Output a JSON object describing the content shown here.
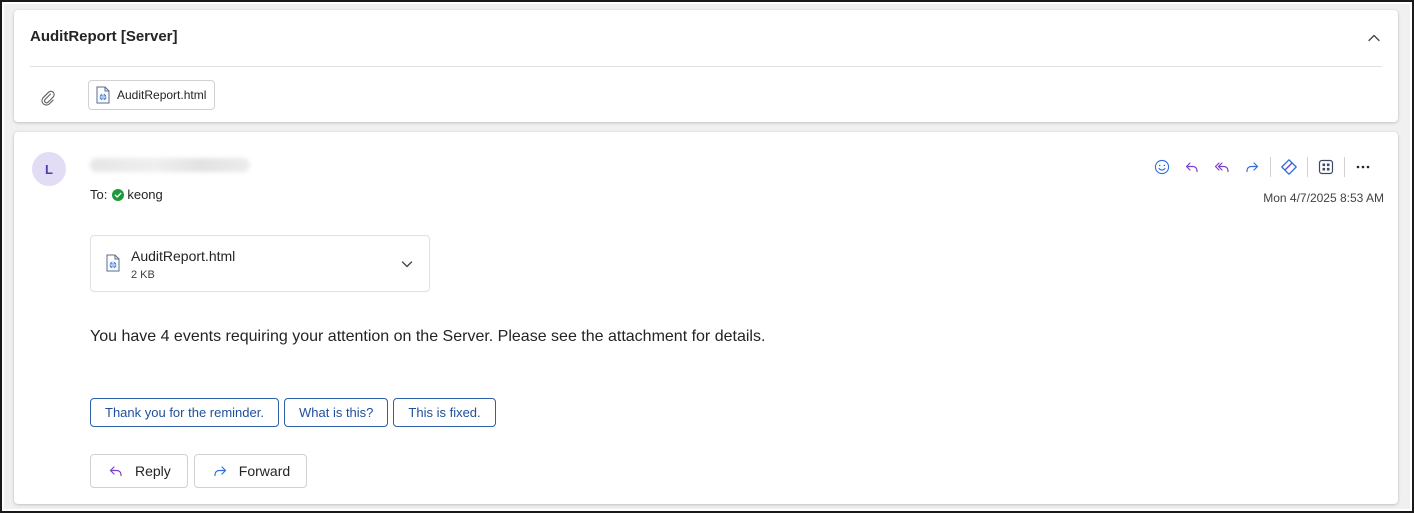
{
  "header": {
    "subject": "AuditReport [Server]",
    "attachment_name": "AuditReport.html"
  },
  "message": {
    "avatar_initial": "L",
    "to_label": "To:",
    "recipient": "keong",
    "timestamp": "Mon 4/7/2025 8:53 AM",
    "attachment": {
      "name": "AuditReport.html",
      "size": "2 KB"
    },
    "body": "You have 4 events requiring your attention on the Server. Please see the attachment for details.",
    "quick_replies": [
      "Thank you for the reminder.",
      "What is this?",
      "This is fixed."
    ],
    "reply_label": "Reply",
    "forward_label": "Forward"
  },
  "icons": {
    "actions": [
      "emoji-icon",
      "reply-icon",
      "reply-all-icon",
      "forward-icon",
      "loop-icon",
      "apps-icon",
      "more-icon"
    ]
  },
  "colors": {
    "accent": "#7d3fc9",
    "action_blue": "#2b6fe0",
    "presence_green": "#1f9a3a",
    "avatar_bg": "#e2dcf5",
    "quick_reply_border": "#2f5fa8"
  }
}
